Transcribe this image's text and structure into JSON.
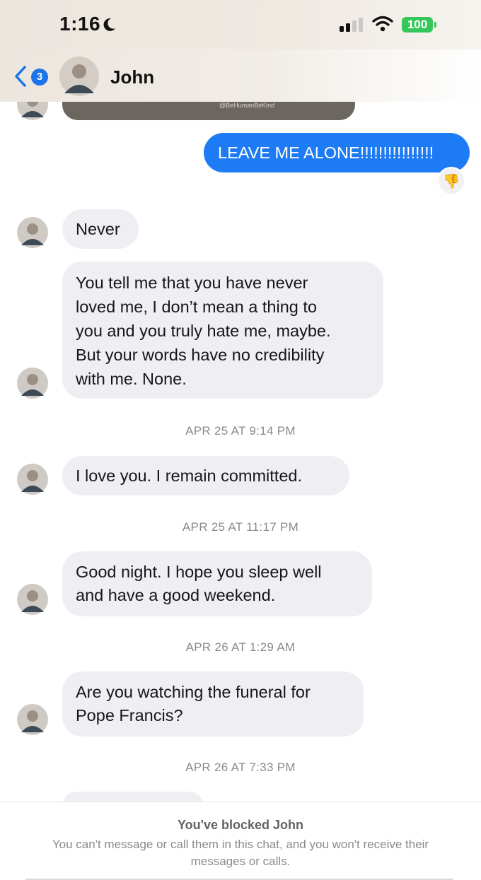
{
  "status_bar": {
    "time": "1:16",
    "battery": "100"
  },
  "header": {
    "back_count": "3",
    "contact_name": "John"
  },
  "shared_media": {
    "caption": "@BeHumanBeKind"
  },
  "messages": {
    "outgoing_1": "LEAVE ME ALONE!!!!!!!!!!!!!!!!",
    "reaction": "👎",
    "in_1": "Never",
    "in_2_lines": [
      "You tell me that you have never",
      "loved me, I don’t mean a thing to",
      "you and you truly hate me, maybe.",
      "But your words have no credibility",
      "with me. None."
    ],
    "ts_1": "APR 25 AT 9:14 PM",
    "in_3": "I love you. I remain committed.",
    "ts_2": "APR 25 AT 11:17 PM",
    "in_4_lines": [
      "Good night. I hope you sleep well",
      "and have a good weekend."
    ],
    "ts_3": "APR 26 AT 1:29 AM",
    "in_5_lines": [
      "Are you watching the funeral for",
      "Pope Francis?"
    ],
    "ts_4": "APR 26 AT 7:33 PM"
  },
  "footer": {
    "title": "You've blocked John",
    "desc": "You can't message or call them in this chat, and you won't receive their messages or calls."
  },
  "colors": {
    "outgoing": "#1e7bf6",
    "incoming": "#efeff3",
    "battery": "#35c759",
    "badge": "#1a73e8"
  }
}
